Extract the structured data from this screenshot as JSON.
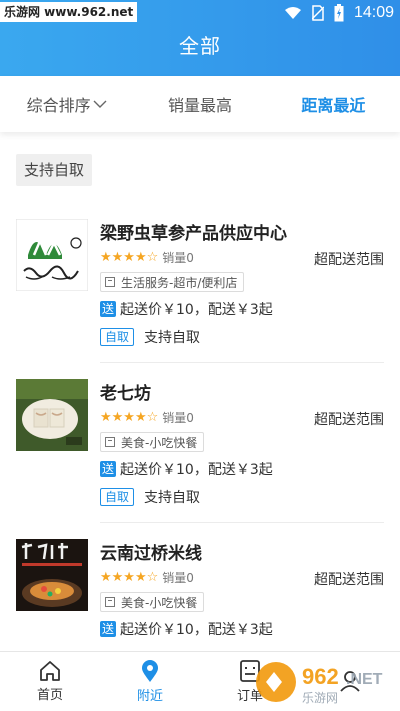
{
  "statusbar": {
    "watermark": "乐游网 www.962.net",
    "time": "14:09"
  },
  "header": {
    "title": "全部"
  },
  "sort_tabs": [
    {
      "label": "综合排序",
      "dropdown": true,
      "active": false
    },
    {
      "label": "销量最高",
      "active": false
    },
    {
      "label": "距离最近",
      "active": true
    }
  ],
  "filter_chip": "支持自取",
  "stores": [
    {
      "name": "梁野虫草参产品供应中心",
      "rating": 4,
      "sales": "销量0",
      "delivery_range": "超配送范围",
      "category": "生活服务-超市/便利店",
      "fee_badge": "送",
      "fee": "起送价￥10，配送￥3起",
      "pickup_badge": "自取",
      "pickup_text": "支持自取"
    },
    {
      "name": "老七坊",
      "rating": 4,
      "sales": "销量0",
      "delivery_range": "超配送范围",
      "category": "美食-小吃快餐",
      "fee_badge": "送",
      "fee": "起送价￥10，配送￥3起",
      "pickup_badge": "自取",
      "pickup_text": "支持自取"
    },
    {
      "name": "云南过桥米线",
      "rating": 4,
      "sales": "销量0",
      "delivery_range": "超配送范围",
      "category": "美食-小吃快餐",
      "fee_badge": "送",
      "fee": "起送价￥10，配送￥3起"
    }
  ],
  "bottom_nav": [
    {
      "label": "首页",
      "icon": "home-icon",
      "active": false
    },
    {
      "label": "附近",
      "icon": "location-pin-icon",
      "active": true
    },
    {
      "label": "订单",
      "icon": "order-icon",
      "active": false
    }
  ],
  "corner_watermark": "乐游网",
  "colors": {
    "accent": "#1e8fe6",
    "star": "#f5a623",
    "header_start": "#3aa8ef",
    "header_end": "#2f8fe8"
  }
}
